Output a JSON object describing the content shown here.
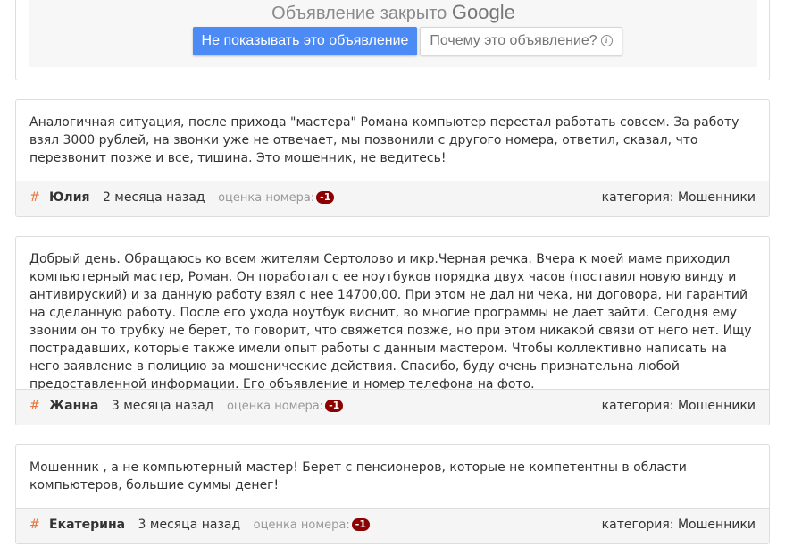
{
  "ad": {
    "closed_text": "Объявление закрыто",
    "brand": "Google",
    "hide_button": "Не показывать это объявление",
    "why_button": "Почему это объявление?",
    "info_glyph": "i"
  },
  "reviews": [
    {
      "text": "Аналогичная ситуация, после прихода \"мастера\" Романа компьютер перестал работать совсем. За работу взял 3000 рублей, на звонки уже не отвечает, мы позвонили с другого номера, ответил, сказал, что перезвонит позже и все, тишина. Это мошенник, не ведитесь!",
      "hash": "#",
      "author": "Юлия",
      "time": "2 месяца назад",
      "rating_label": "оценка номера:",
      "rating": "-1",
      "category": "категория: Мошенники"
    },
    {
      "text": "Добрый день. Обращаюсь ко всем жителям Сертолово и мкр.Черная речка. Вчера к моей маме приходил компьютерный мастер, Роман. Он поработал с ее ноутбуков порядка двух часов (поставил новую винду и антивируский) и за данную работу взял с нее 14700,00. При этом не дал ни чека, ни договора, ни гарантий на сделанную работу. После его ухода ноутбук виснит, во многие программы не дает зайти. Сегодня ему звоним он то трубку не берет, то говорит, что свяжется позже, но при этом никакой связи от него нет. Ищу пострадавших, которые также имели опыт работы с данным мастером. Чтобы коллективно написать на него заявление в полицию за мошенические действия. Спасибо, буду очень признательна любой предоставленной информации. Его объявление и номер телефона на фото.",
      "hash": "#",
      "author": "Жанна",
      "time": "3 месяца назад",
      "rating_label": "оценка номера:",
      "rating": "-1",
      "category": "категория: Мошенники"
    },
    {
      "text": "Мошенник , а не компьютерный мастер! Берет с пенсионеров, которые не компетентны в области компьютеров, большие суммы денег!",
      "hash": "#",
      "author": "Екатерина",
      "time": "3 месяца назад",
      "rating_label": "оценка номера:",
      "rating": "-1",
      "category": "категория: Мошенники"
    }
  ]
}
